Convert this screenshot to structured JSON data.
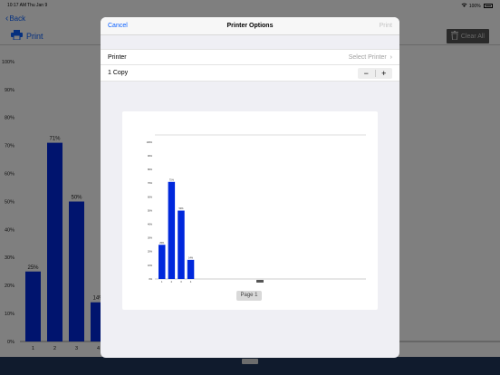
{
  "status_bar": {
    "time": "10:17 AM",
    "date": "Thu Jan 9",
    "battery": "100%"
  },
  "nav": {
    "back_label": "Back"
  },
  "toolbar": {
    "print_label": "Print",
    "clear_all_label": "Clear All"
  },
  "modal": {
    "cancel_label": "Cancel",
    "title": "Printer Options",
    "print_label": "Print",
    "printer_label": "Printer",
    "printer_value": "Select Printer",
    "copies_label": "1 Copy",
    "minus": "−",
    "plus": "+",
    "page_label": "Page 1"
  },
  "colors": {
    "accent": "#0a60ff",
    "bar": "#0028dc",
    "bottom_bar": "#20365a"
  },
  "icons": [
    "chevron-left-icon",
    "printer-icon",
    "trash-icon",
    "chevron-right-icon",
    "battery-icon"
  ],
  "chart_data": [
    {
      "type": "bar",
      "categories": [
        "1",
        "2",
        "3",
        "4"
      ],
      "values": [
        25,
        71,
        50,
        14
      ],
      "data_labels": [
        "25%",
        "71%",
        "50%",
        "14%"
      ],
      "y_ticks": [
        "0%",
        "10%",
        "20%",
        "30%",
        "40%",
        "50%",
        "60%",
        "70%",
        "80%",
        "90%",
        "100%"
      ],
      "ylim": [
        0,
        100
      ],
      "grid": false
    },
    {
      "type": "bar",
      "categories": [
        "1",
        "2",
        "3",
        "4"
      ],
      "values": [
        25,
        71,
        50,
        14
      ],
      "data_labels": [
        "25%",
        "71%",
        "50%",
        "14%"
      ],
      "y_ticks": [
        "0%",
        "10%",
        "20%",
        "30%",
        "40%",
        "50%",
        "60%",
        "70%",
        "80%",
        "90%",
        "100%"
      ],
      "ylim": [
        0,
        100
      ],
      "grid": false
    }
  ]
}
